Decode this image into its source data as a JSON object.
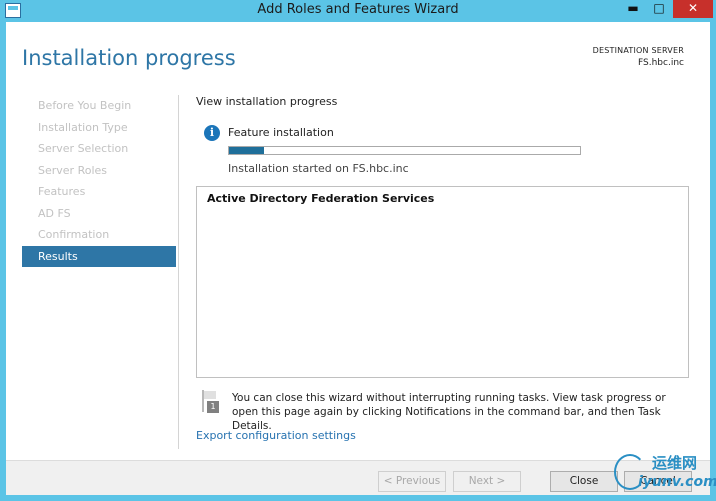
{
  "window": {
    "title": "Add Roles and Features Wizard",
    "controls": {
      "minimize": "▬",
      "maximize": "□",
      "close": "✕"
    }
  },
  "header": {
    "page_title": "Installation progress",
    "destination_label": "DESTINATION SERVER",
    "destination_value": "FS.hbc.inc"
  },
  "nav": {
    "items": [
      {
        "label": "Before You Begin"
      },
      {
        "label": "Installation Type"
      },
      {
        "label": "Server Selection"
      },
      {
        "label": "Server Roles"
      },
      {
        "label": "Features"
      },
      {
        "label": "AD FS"
      },
      {
        "label": "Confirmation"
      },
      {
        "label": "Results"
      }
    ],
    "active_index": 7
  },
  "content": {
    "heading": "View installation progress",
    "info_icon": "i",
    "feature_label": "Feature installation",
    "progress_fraction": 0.1,
    "started_text": "Installation started on FS.hbc.inc",
    "results_items": [
      "Active Directory Federation Services"
    ],
    "notice_badge": "1",
    "notice_text": "You can close this wizard without interrupting running tasks. View task progress or open this page again by clicking Notifications in the command bar, and then Task Details.",
    "export_link": "Export configuration settings"
  },
  "footer": {
    "previous": "< Previous",
    "next": "Next >",
    "close": "Close",
    "cancel": "Cancel"
  },
  "watermark": {
    "cn": "运维网",
    "en": "iyunv.com"
  },
  "colors": {
    "titlebar": "#5bc4e6",
    "accent": "#2e76a6",
    "progress_fill": "#1f6f9a",
    "link": "#2672b0",
    "close_button": "#c7302b"
  }
}
